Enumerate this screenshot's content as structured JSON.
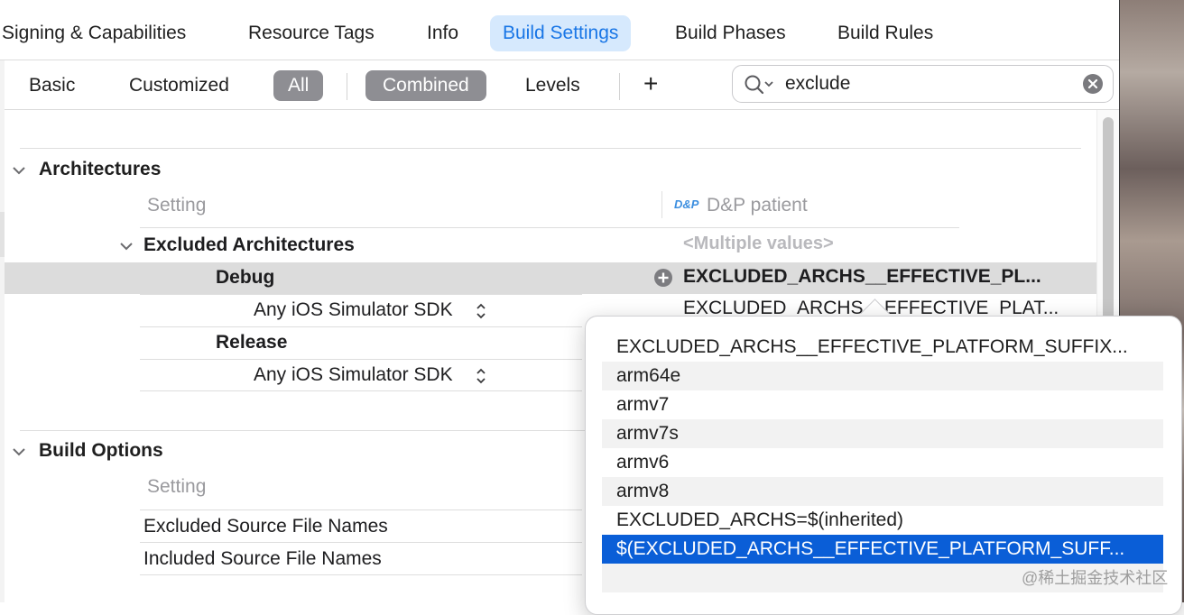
{
  "tabs": [
    {
      "label": "Signing & Capabilities",
      "active": false
    },
    {
      "label": "Resource Tags",
      "active": false
    },
    {
      "label": "Info",
      "active": false
    },
    {
      "label": "Build Settings",
      "active": true
    },
    {
      "label": "Build Phases",
      "active": false
    },
    {
      "label": "Build Rules",
      "active": false
    }
  ],
  "filter": {
    "basic": "Basic",
    "customized": "Customized",
    "all": "All",
    "combined": "Combined",
    "levels": "Levels",
    "add": "+",
    "search_value": "exclude"
  },
  "architectures": {
    "title": "Architectures",
    "setting_header": "Setting",
    "target_name": "D&P patient",
    "target_icon_text": "D&P",
    "excluded": {
      "title": "Excluded Architectures",
      "value": "<Multiple values>",
      "debug_label": "Debug",
      "debug_value": "EXCLUDED_ARCHS__EFFECTIVE_PL...",
      "debug_sdk": "Any iOS Simulator SDK",
      "debug_sdk_value": "EXCLUDED_ARCHS__EFFECTIVE_PLAT...",
      "release_label": "Release",
      "release_sdk": "Any iOS Simulator SDK"
    }
  },
  "build_options": {
    "title": "Build Options",
    "setting_header": "Setting",
    "rows": [
      "Excluded Source File Names",
      "Included Source File Names"
    ]
  },
  "popup": {
    "items": [
      "EXCLUDED_ARCHS__EFFECTIVE_PLATFORM_SUFFIX...",
      "arm64e",
      "armv7",
      "armv7s",
      "armv6",
      "armv8",
      "EXCLUDED_ARCHS=$(inherited)",
      "$(EXCLUDED_ARCHS__EFFECTIVE_PLATFORM_SUFF..."
    ],
    "selected_index": 7
  },
  "watermark": "@稀土掘金技术社区",
  "colors": {
    "accent": "#1976e6",
    "tab_active_bg": "#d6e9fd",
    "selection_blue": "#0a5ed7",
    "segment_selected": "#8e8e93"
  }
}
